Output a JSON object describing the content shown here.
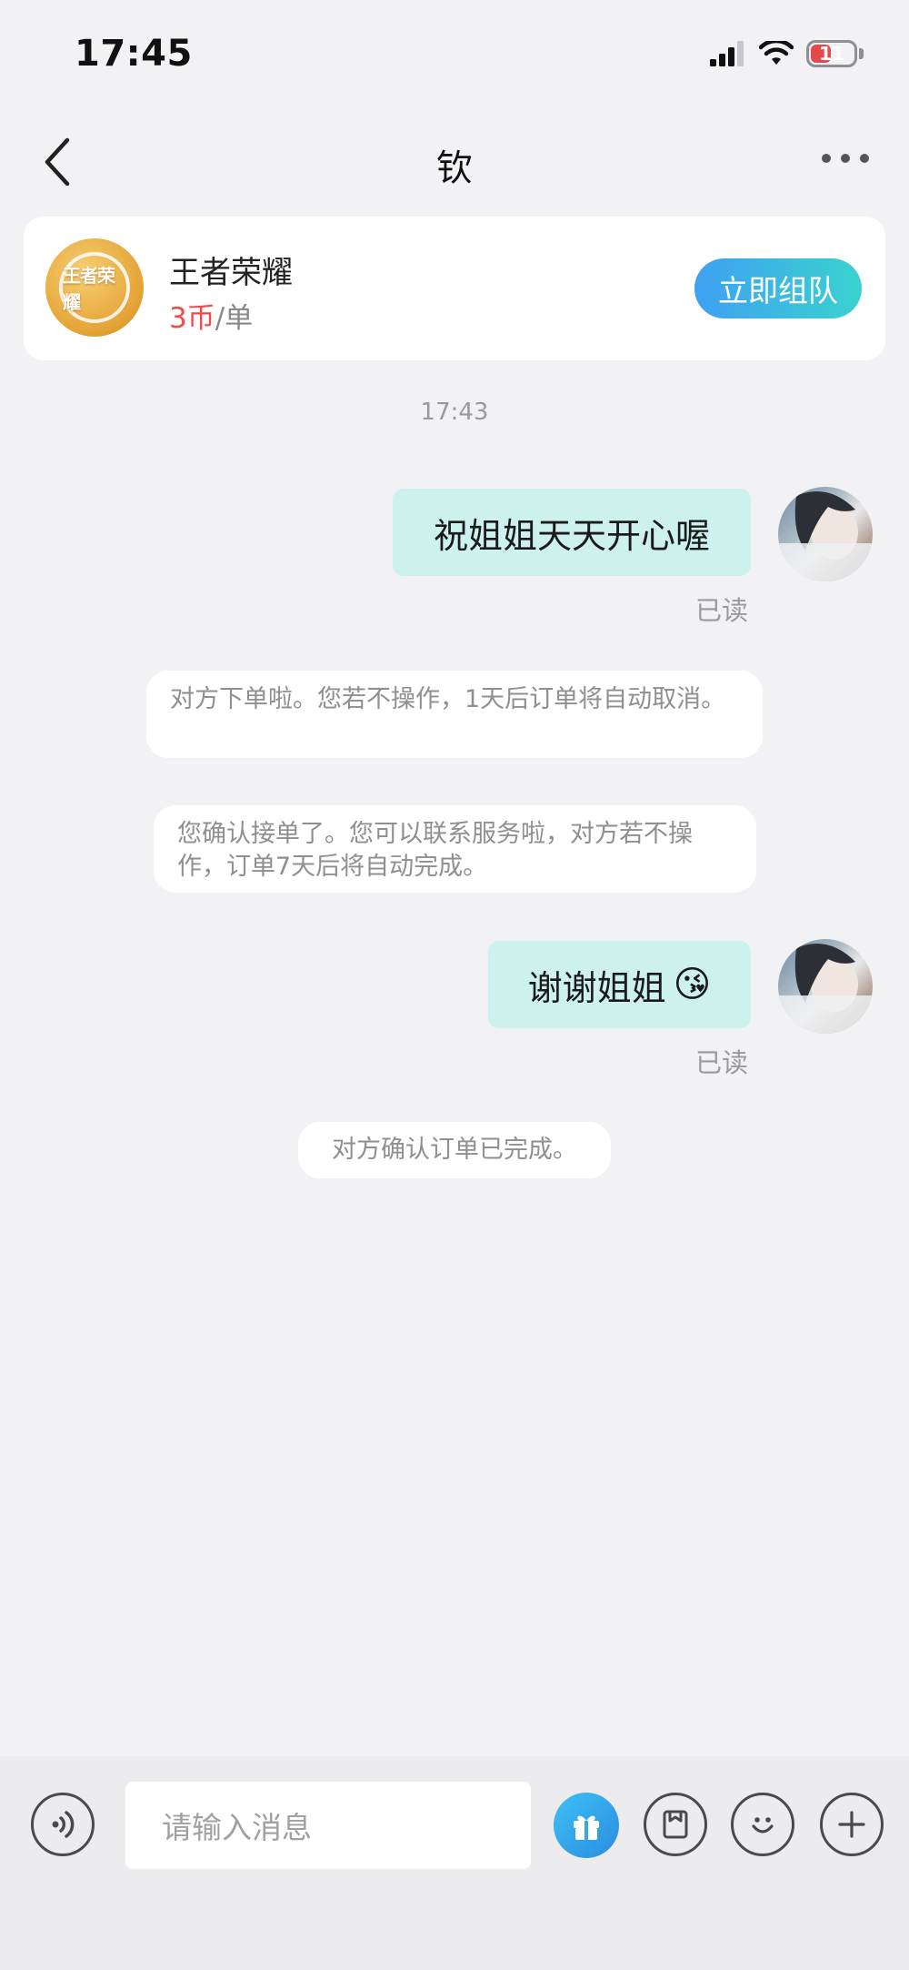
{
  "status_bar": {
    "time": "17:45",
    "battery": "11"
  },
  "nav": {
    "title": "钦"
  },
  "game_card": {
    "name": "王者荣耀",
    "price_number": "3",
    "price_unit": "币",
    "price_suffix": "/单",
    "logo_text": "王者荣耀",
    "button_label": "立即组队"
  },
  "chat": {
    "timestamp": "17:43",
    "messages": [
      {
        "text": "祝姐姐天天开心喔",
        "status": "已读"
      },
      {
        "text": "谢谢姐姐",
        "emoji": "😘",
        "status": "已读"
      }
    ],
    "system_notices": [
      "对方下单啦。您若不操作，1天后订单将自动取消。",
      "您确认接单了。您可以联系服务啦，对方若不操作，订单7天后将自动完成。",
      "对方确认订单已完成。"
    ]
  },
  "input": {
    "placeholder": "请输入消息"
  },
  "icons": {
    "voice": "voice-icon",
    "gift": "gift-icon",
    "order": "order-icon",
    "emoji": "emoji-icon",
    "add": "add-icon"
  },
  "colors": {
    "accent_gradient_start": "#3fa0f2",
    "accent_gradient_end": "#39d3cf",
    "outgoing_bubble": "#cdf2ee",
    "price_red": "#ef4b4b"
  }
}
